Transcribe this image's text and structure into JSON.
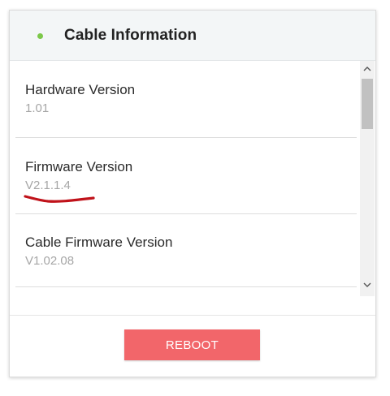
{
  "header": {
    "title": "Cable Information",
    "status_color": "#7cc84a"
  },
  "info": [
    {
      "label": "Hardware Version",
      "value": "1.01"
    },
    {
      "label": "Firmware Version",
      "value": "V2.1.1.4"
    },
    {
      "label": "Cable Firmware Version",
      "value": "V1.02.08"
    }
  ],
  "scrollbar": {
    "up_icon": "chevron-up-icon",
    "down_icon": "chevron-down-icon"
  },
  "footer": {
    "reboot_label": "REBOOT",
    "reboot_color": "#f2666a"
  },
  "annotation": {
    "color": "#c0121a"
  }
}
